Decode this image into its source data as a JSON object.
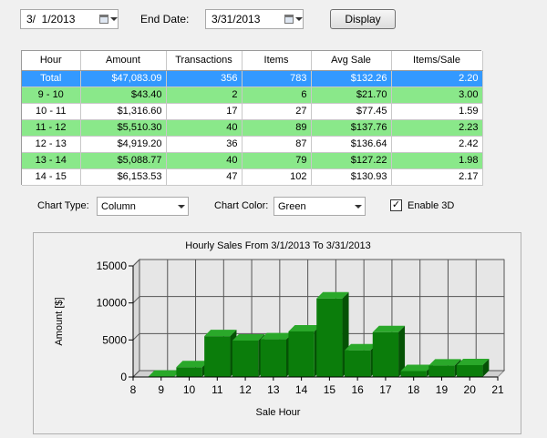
{
  "controls": {
    "start_date": "3/  1/2013",
    "end_date_label": "End Date:",
    "end_date": "3/31/2013",
    "display_button": "Display",
    "chart_type_label": "Chart Type:",
    "chart_type_value": "Column",
    "chart_color_label": "Chart Color:",
    "chart_color_value": "Green",
    "enable3d_label": "Enable 3D",
    "enable3d_checked": true
  },
  "table": {
    "columns": [
      "Hour",
      "Amount",
      "Transactions",
      "Items",
      "Avg Sale",
      "Items/Sale"
    ],
    "rows": [
      {
        "style": "total",
        "cells": [
          "Total",
          "$47,083.09",
          "356",
          "783",
          "$132.26",
          "2.20"
        ]
      },
      {
        "style": "g",
        "cells": [
          "9 - 10",
          "$43.40",
          "2",
          "6",
          "$21.70",
          "3.00"
        ]
      },
      {
        "style": "w",
        "cells": [
          "10 - 11",
          "$1,316.60",
          "17",
          "27",
          "$77.45",
          "1.59"
        ]
      },
      {
        "style": "g",
        "cells": [
          "11 - 12",
          "$5,510.30",
          "40",
          "89",
          "$137.76",
          "2.23"
        ]
      },
      {
        "style": "w",
        "cells": [
          "12 - 13",
          "$4,919.20",
          "36",
          "87",
          "$136.64",
          "2.42"
        ]
      },
      {
        "style": "g",
        "cells": [
          "13 - 14",
          "$5,088.77",
          "40",
          "79",
          "$127.22",
          "1.98"
        ]
      },
      {
        "style": "w",
        "cells": [
          "14 - 15",
          "$6,153.53",
          "47",
          "102",
          "$130.93",
          "2.17"
        ]
      }
    ]
  },
  "chart_data": {
    "type": "bar",
    "title": "Hourly Sales From 3/1/2013 To 3/31/2013",
    "xlabel": "Sale Hour",
    "ylabel": "Amount [$]",
    "xlim": [
      8,
      21
    ],
    "ylim": [
      0,
      15000
    ],
    "x_ticks": [
      8,
      9,
      10,
      11,
      12,
      13,
      14,
      15,
      16,
      17,
      18,
      19,
      20,
      21
    ],
    "y_ticks": [
      0,
      5000,
      10000,
      15000
    ],
    "y_tick_labels": [
      "0",
      "5000",
      "10000",
      "15000"
    ],
    "categories": [
      9,
      10,
      11,
      12,
      13,
      14,
      15,
      16,
      17,
      18,
      19,
      20
    ],
    "values": [
      43.4,
      1316.6,
      5510.3,
      4919.2,
      5088.77,
      6153.53,
      10600,
      3600,
      6050,
      800,
      1550,
      1600
    ],
    "grid": true,
    "legend": "none",
    "color": "#0b7d0b"
  }
}
